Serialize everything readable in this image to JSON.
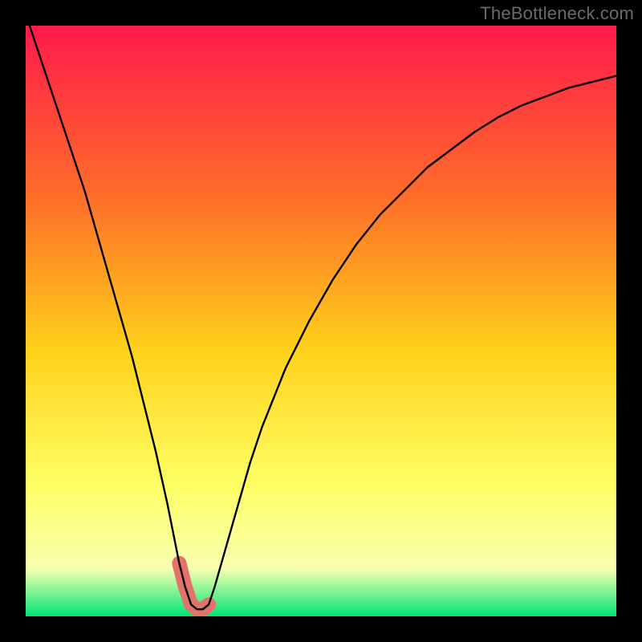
{
  "watermark": "TheBottleneck.com",
  "colors": {
    "gradient_top": "#ff1a4b",
    "gradient_mid1": "#ff6a2a",
    "gradient_mid2": "#ffd21a",
    "gradient_mid3": "#ffff66",
    "gradient_mid4": "#f7ffb0",
    "gradient_bottom": "#00e676",
    "curve": "#000000",
    "highlight": "#e2726a",
    "frame": "#000000"
  },
  "chart_data": {
    "type": "line",
    "title": "",
    "xlabel": "",
    "ylabel": "",
    "xlim": [
      0,
      100
    ],
    "ylim": [
      0,
      100
    ],
    "notch_x": 28,
    "highlight_range_x": [
      25.5,
      31
    ],
    "series": [
      {
        "name": "bottleneck-curve",
        "x": [
          0,
          2,
          4,
          6,
          8,
          10,
          12,
          14,
          16,
          18,
          20,
          22,
          24,
          25,
          26,
          27,
          28,
          29,
          30,
          31,
          32,
          34,
          36,
          38,
          40,
          44,
          48,
          52,
          56,
          60,
          64,
          68,
          72,
          76,
          80,
          84,
          88,
          92,
          96,
          100
        ],
        "y": [
          102,
          96,
          90,
          84,
          78,
          72,
          65,
          58,
          51,
          44,
          36,
          28,
          19,
          14,
          9,
          5,
          2,
          1.2,
          1.2,
          2,
          5,
          12,
          19,
          26,
          32,
          42,
          50,
          57,
          63,
          68,
          72,
          76,
          79,
          82,
          84.5,
          86.5,
          88,
          89.5,
          90.5,
          91.5
        ]
      }
    ],
    "annotations": []
  }
}
